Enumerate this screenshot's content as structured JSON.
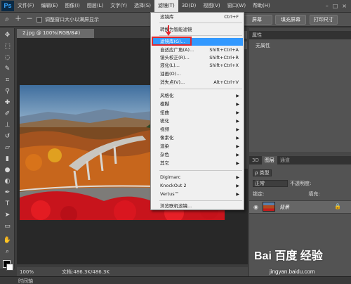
{
  "app": {
    "logo": "Ps"
  },
  "menubar": {
    "items": [
      "文件(F)",
      "编辑(E)",
      "图像(I)",
      "图层(L)",
      "文字(Y)",
      "选择(S)",
      "滤镜(T)",
      "3D(D)",
      "视图(V)",
      "窗口(W)",
      "帮助(H)"
    ],
    "active_index": 6
  },
  "options": {
    "zoom_in": "＋",
    "zoom_out": "－",
    "checkbox1": "调整窗口大小以满屏显示",
    "btn_fill": "屏幕",
    "btn_fillscreen": "填充屏幕",
    "btn_print": "打印尺寸"
  },
  "document": {
    "tab": "2.jpg @ 100%(RGB/8#)",
    "zoom": "100%",
    "docinfo": "文档:486.3K/486.3K",
    "timeline": "时间轴"
  },
  "filter_menu": {
    "items": [
      {
        "label": "滤镜库",
        "shortcut": "Ctrl+F"
      },
      {
        "label": "转换为智能滤镜",
        "shortcut": ""
      },
      {
        "label": "滤镜库(G)...",
        "shortcut": "",
        "highlighted": true
      },
      {
        "label": "自适应广角(A)...",
        "shortcut": "Shift+Ctrl+A"
      },
      {
        "label": "镜头校正(R)...",
        "shortcut": "Shift+Ctrl+R"
      },
      {
        "label": "液化(L)...",
        "shortcut": "Shift+Ctrl+X"
      },
      {
        "label": "油画(O)...",
        "shortcut": ""
      },
      {
        "label": "消失点(V)...",
        "shortcut": "Alt+Ctrl+V"
      },
      {
        "label": "风格化",
        "submenu": true
      },
      {
        "label": "模糊",
        "submenu": true
      },
      {
        "label": "扭曲",
        "submenu": true
      },
      {
        "label": "锐化",
        "submenu": true
      },
      {
        "label": "视频",
        "submenu": true
      },
      {
        "label": "像素化",
        "submenu": true
      },
      {
        "label": "渲染",
        "submenu": true
      },
      {
        "label": "杂色",
        "submenu": true
      },
      {
        "label": "其它",
        "submenu": true
      },
      {
        "label": "Digimarc",
        "submenu": true
      },
      {
        "label": "KnockOut 2",
        "submenu": true
      },
      {
        "label": "Vertus™",
        "submenu": true
      },
      {
        "label": "浏览联机滤镜...",
        "shortcut": ""
      }
    ]
  },
  "properties": {
    "title": "属性",
    "empty": "无属性"
  },
  "layers": {
    "tabs": [
      "3D",
      "图层",
      "通道"
    ],
    "active_tab": 1,
    "kind": "ρ 类型",
    "blend": "正常",
    "opacity_label": "不透明度:",
    "lock_label": "锁定:",
    "fill_label": "填充:",
    "layer_name": "背景"
  },
  "watermark": {
    "brand": "Bai 百度 经验",
    "url": "jingyan.baidu.com"
  },
  "colors": {
    "highlight": "#3399ff",
    "annotation": "#e0282e"
  }
}
